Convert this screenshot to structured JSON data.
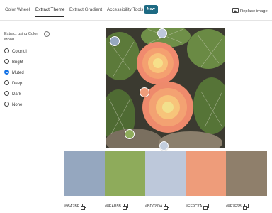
{
  "nav": {
    "tabs": [
      {
        "label": "Color Wheel"
      },
      {
        "label": "Extract Theme"
      },
      {
        "label": "Extract Gradient"
      },
      {
        "label": "Accessibility Tools"
      }
    ],
    "active_tab": "Extract Theme",
    "new_badge": "New",
    "replace_image": "Replace image"
  },
  "mood": {
    "title": "Extract using Color Mood",
    "info": "?",
    "options": [
      "Colorful",
      "Bright",
      "Muted",
      "Deep",
      "Dark",
      "None"
    ],
    "selected": "Muted"
  },
  "image": {
    "subject": "cactus flowers"
  },
  "swatches": [
    {
      "hex": "#95A7BF",
      "color": "#95A7BF"
    },
    {
      "hex": "#8EAB5B",
      "color": "#8EAB5B"
    },
    {
      "hex": "#BDC8DA",
      "color": "#BDC8DA"
    },
    {
      "hex": "#EE9C7A",
      "color": "#EE9C7A"
    },
    {
      "hex": "#8F7F6B",
      "color": "#8F7F6B"
    }
  ],
  "colors": {
    "accent": "#1473e6",
    "badge": "#1d6a83"
  }
}
